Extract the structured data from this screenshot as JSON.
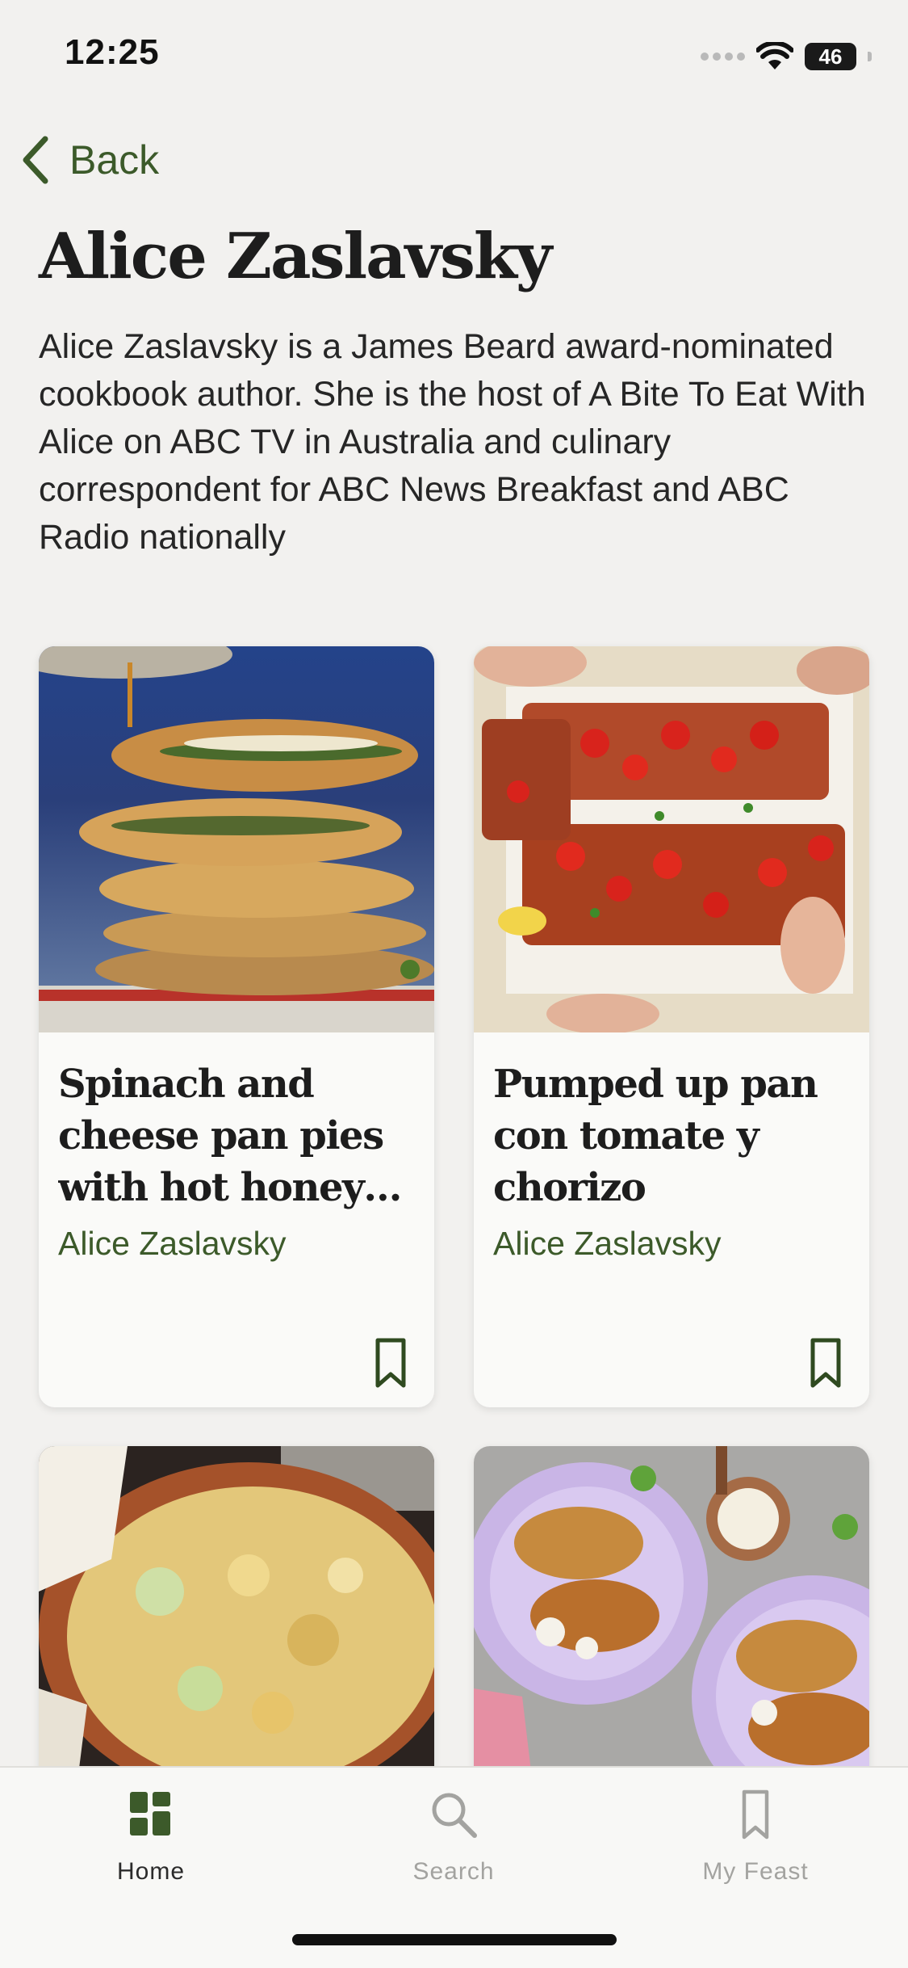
{
  "status_bar": {
    "time": "12:25",
    "battery": "46"
  },
  "nav": {
    "back_label": "Back"
  },
  "profile": {
    "name": "Alice Zaslavsky",
    "bio": "Alice Zaslavsky is a James Beard award-nominated cookbook author. She is the host of A Bite To Eat With Alice on ABC TV in Australia and culinary correspondent for ABC News Breakfast and ABC Radio nationally"
  },
  "recipes": [
    {
      "title": "Spinach and cheese pan pies with hot honey d...",
      "author": "Alice Zaslavsky",
      "bookmark_icon": "bookmark-outline-icon"
    },
    {
      "title": "Pumped up pan con tomate y chorizo",
      "author": "Alice Zaslavsky",
      "bookmark_icon": "bookmark-outline-icon"
    },
    {
      "title": "",
      "author": ""
    },
    {
      "title": "",
      "author": ""
    }
  ],
  "tab_bar": {
    "tabs": [
      {
        "label": "Home",
        "icon": "grid-home-icon",
        "active": true
      },
      {
        "label": "Search",
        "icon": "search-icon",
        "active": false
      },
      {
        "label": "My Feast",
        "icon": "bookmark-icon",
        "active": false
      }
    ]
  },
  "colors": {
    "accent_green": "#3c5a2a",
    "background": "#f2f1ef",
    "card_background": "#fafaf8",
    "inactive_tab": "#a3a3a0"
  }
}
